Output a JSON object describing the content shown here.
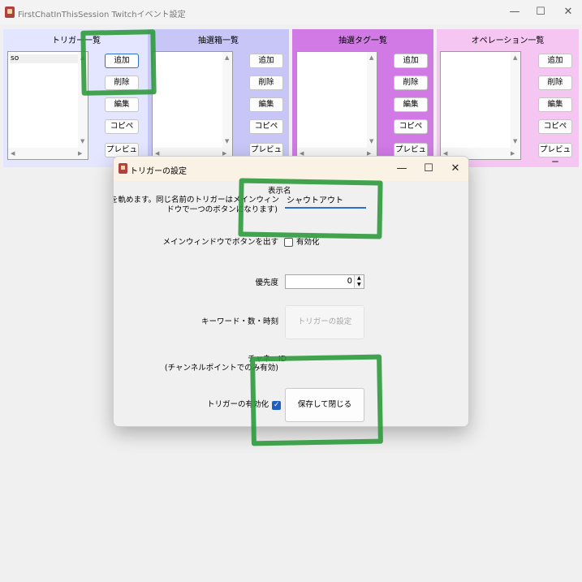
{
  "window": {
    "title": "FirstChatInThisSession Twitchイベント設定",
    "controls": {
      "minimize": "—",
      "maximize": "☐",
      "close": "✕"
    }
  },
  "panels": [
    {
      "title": "トリガー一覧",
      "color": "#e4e5ff",
      "items": [
        "so"
      ]
    },
    {
      "title": "抽選箱一覧",
      "color": "#c8c6f6",
      "items": []
    },
    {
      "title": "抽選タグ一覧",
      "color": "#d17ae6",
      "items": []
    },
    {
      "title": "オペレーション一覧",
      "color": "#f6c6f3",
      "items": []
    }
  ],
  "panel_buttons": {
    "add": "追加",
    "delete": "削除",
    "edit": "編集",
    "copy": "コピペ",
    "preview": "プレビュー"
  },
  "dialog": {
    "title": "トリガーの設定",
    "controls": {
      "minimize": "—",
      "maximize": "☐",
      "close": "✕"
    },
    "display_name_label_1": "表示名",
    "display_name_label_2": "(一意な名前を軌めます。同じ名前のトリガーはメインウィン",
    "display_name_label_3": "ドウで一つのボタンになります)",
    "display_name_value": "シャウトアウト",
    "main_window_button_label": "メインウィンドウでボタンを出す",
    "main_window_enable_label": "有効化",
    "main_window_enabled": false,
    "priority_label": "優先度",
    "priority_value": "0",
    "keyword_label": "キーワード・数・時刻",
    "trigger_settings_button": "トリガーの設定",
    "channel_label_1": "チャネ…ID",
    "channel_label_2": "(チャンネルポイントでのみ有効)",
    "trigger_enable_label": "トリガーの有効化",
    "trigger_enabled": true,
    "save_close_button": "保存して閉じる"
  }
}
